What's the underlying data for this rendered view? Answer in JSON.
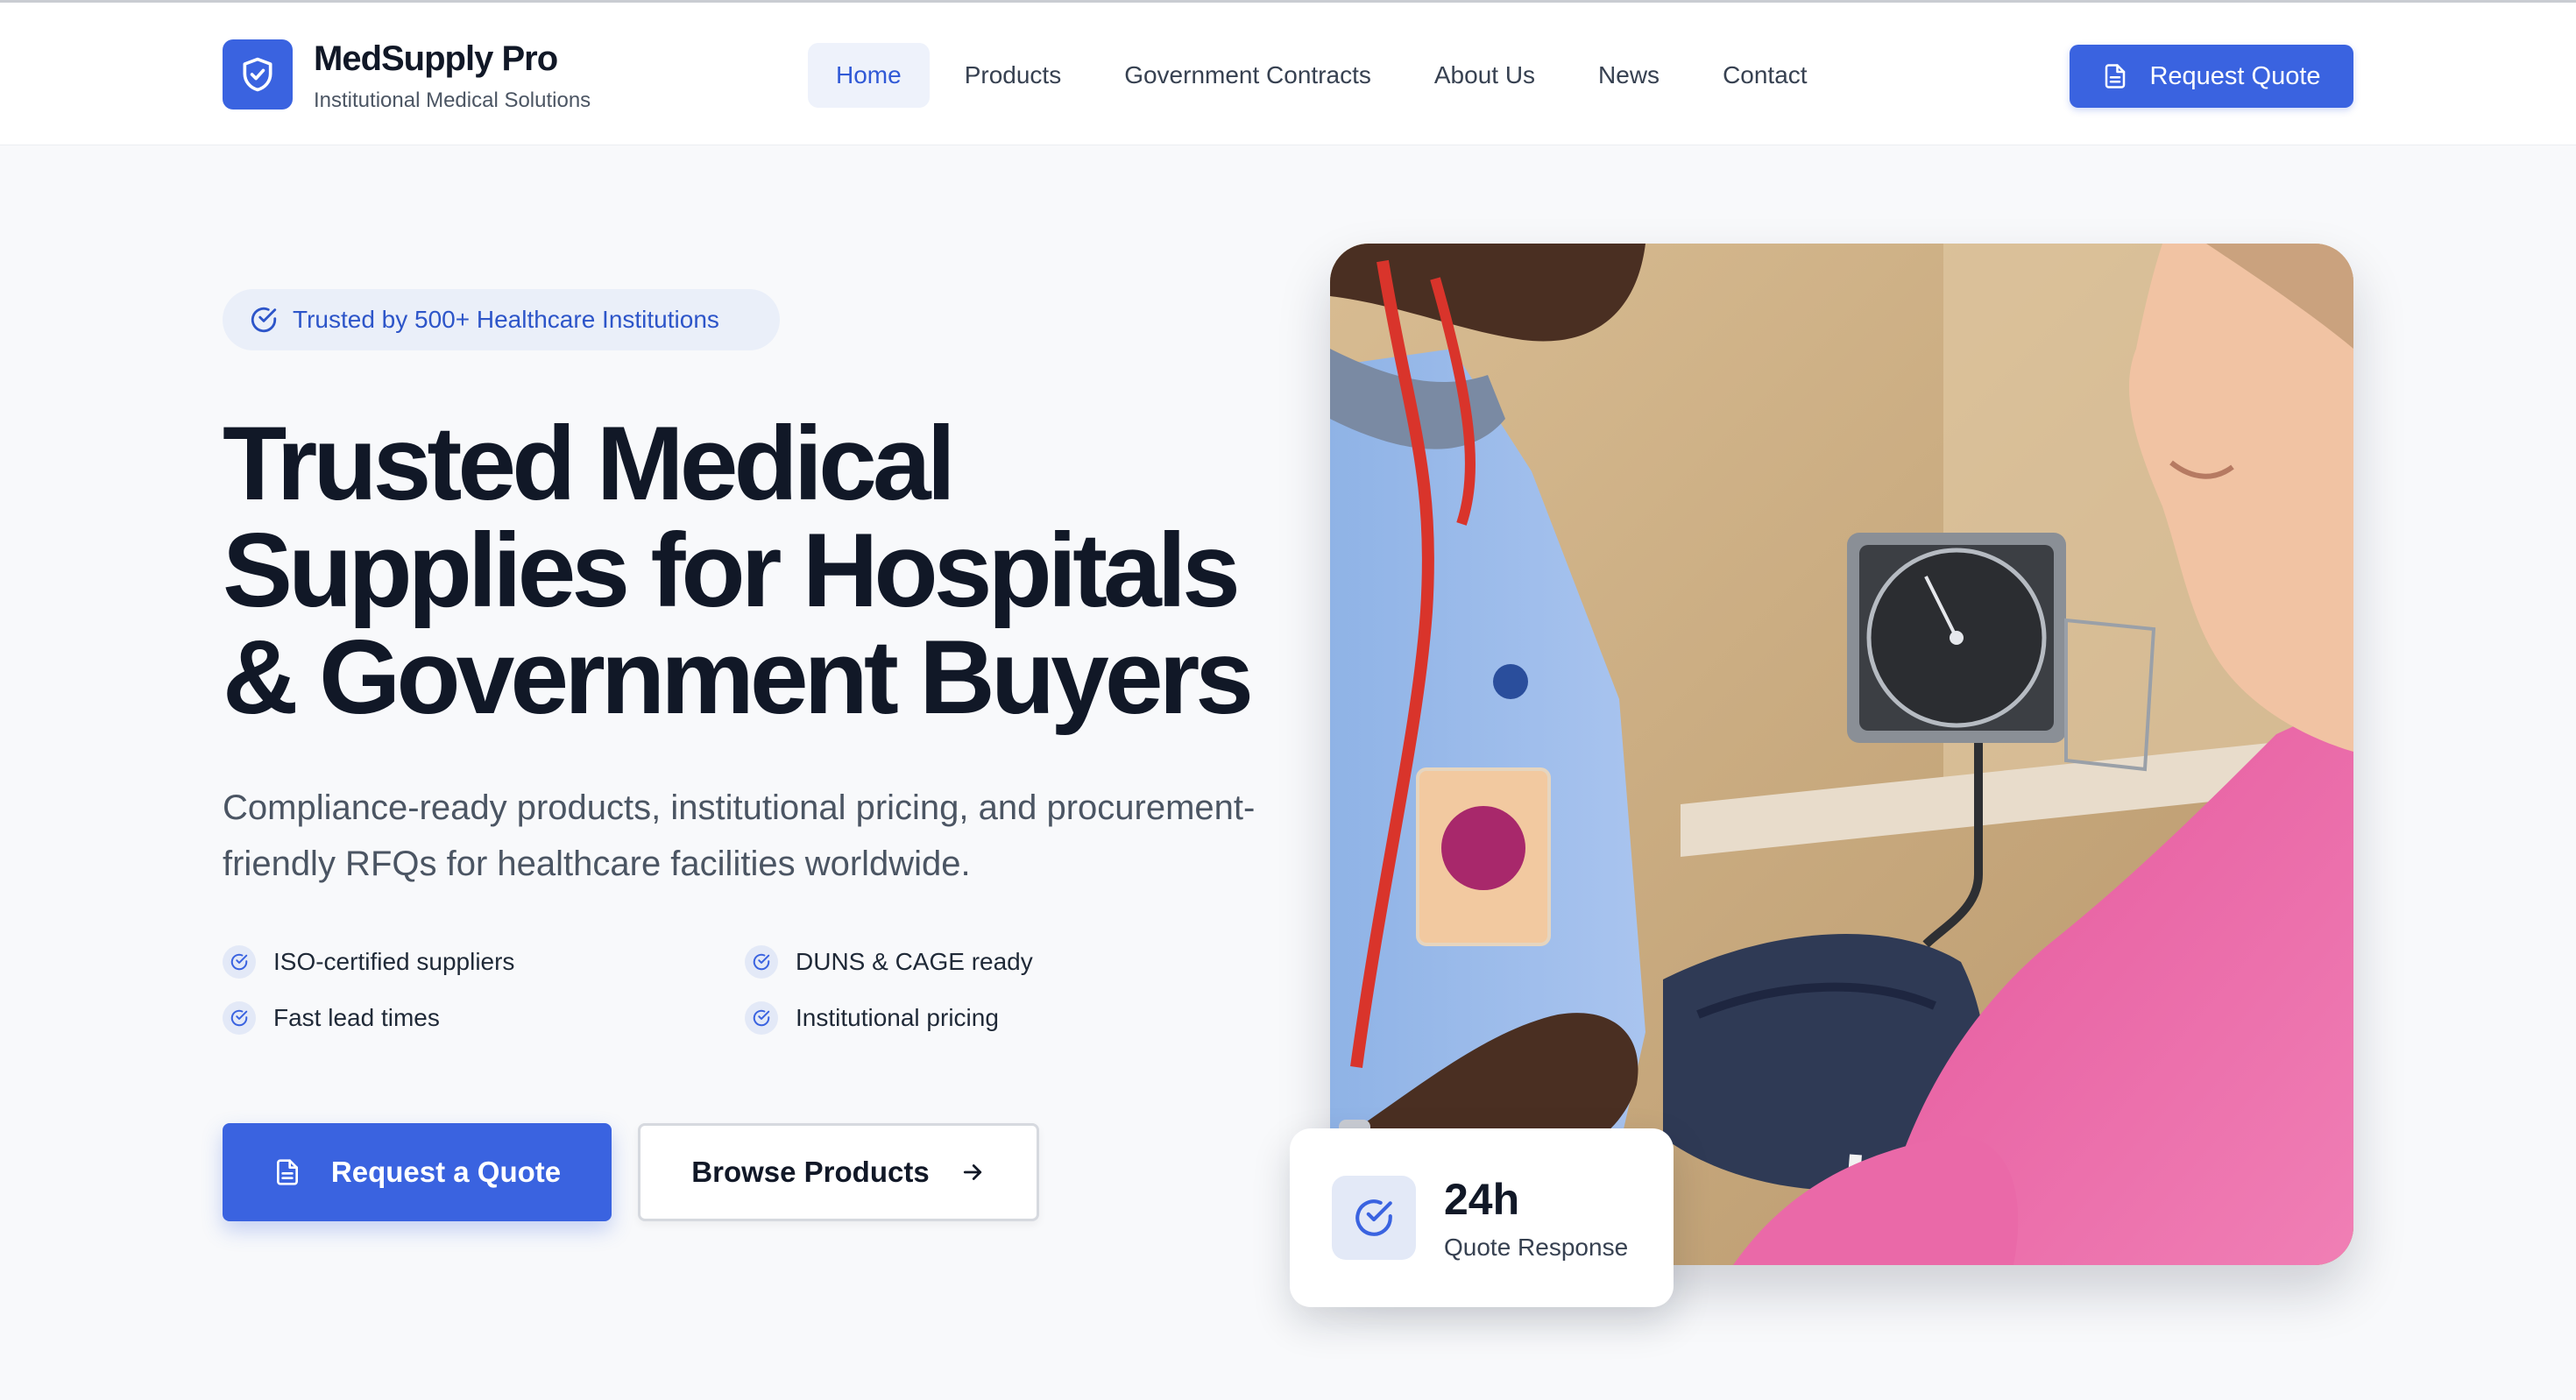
{
  "header": {
    "brand_name": "MedSupply Pro",
    "brand_tagline": "Institutional Medical Solutions",
    "logo_icon": "shield-check-icon",
    "nav": [
      {
        "label": "Home",
        "active": true
      },
      {
        "label": "Products",
        "active": false
      },
      {
        "label": "Government Contracts",
        "active": false
      },
      {
        "label": "About Us",
        "active": false
      },
      {
        "label": "News",
        "active": false
      },
      {
        "label": "Contact",
        "active": false
      }
    ],
    "cta_label": "Request Quote",
    "cta_icon": "document-icon"
  },
  "hero": {
    "badge": "Trusted by 500+ Healthcare Institutions",
    "title_line1": "Trusted Medical",
    "title_line2": "Supplies for Hospitals",
    "title_line3": "& Government Buyers",
    "subtitle": "Compliance-ready products, institutional pricing, and procurement-friendly RFQs for healthcare facilities worldwide.",
    "features": [
      "ISO-certified suppliers",
      "DUNS & CAGE ready",
      "Fast lead times",
      "Institutional pricing"
    ],
    "primary_button": "Request a Quote",
    "secondary_button": "Browse Products"
  },
  "stat_card": {
    "value": "24h",
    "label": "Quote Response",
    "icon": "check-circle-icon"
  },
  "colors": {
    "accent": "#3a63e0",
    "background": "#f8f9fb",
    "heading": "#111827",
    "badge_bg": "#eaeff9"
  }
}
